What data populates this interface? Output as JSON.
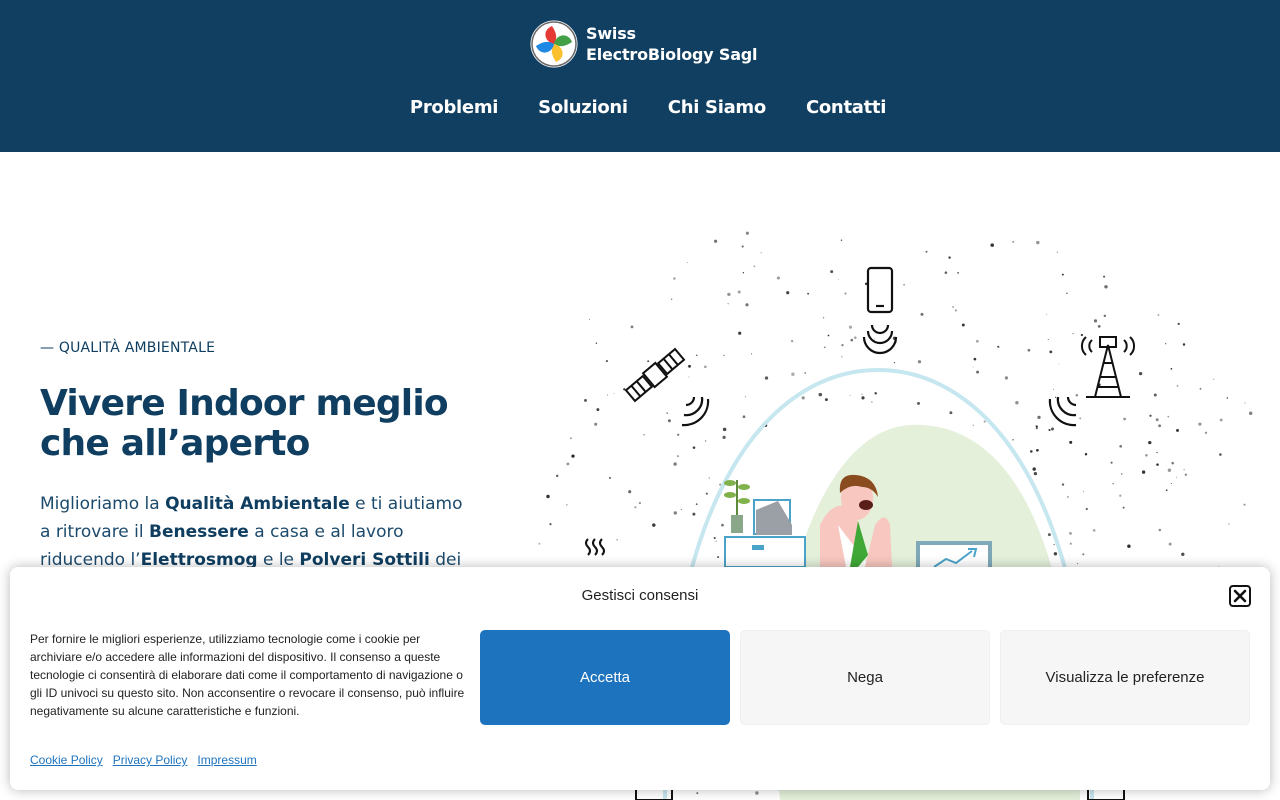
{
  "header": {
    "logo_line1": "Swiss",
    "logo_line2": "ElectroBiology Sagl",
    "nav": [
      "Problemi",
      "Soluzioni",
      "Chi Siamo",
      "Contatti"
    ]
  },
  "hero": {
    "eyebrow": "— QUALITÀ AMBIENTALE",
    "title": "Vivere Indoor meglio che all’aperto",
    "text_1": "Miglioriamo la ",
    "text_b1": "Qualità Ambientale",
    "text_2": " e ti aiutiamo a ritrovare il ",
    "text_b2": "Benessere",
    "text_3": " a casa e al lavoro riducendo l’",
    "text_b3": "Elettrosmog",
    "text_4": " e le ",
    "text_b4": "Polveri Sottili",
    "text_5": " dei tuoi ambienti"
  },
  "cookie": {
    "title": "Gestisci consensi",
    "text": "Per fornire le migliori esperienze, utilizziamo tecnologie come i cookie per archiviare e/o accedere alle informazioni del dispositivo. Il consenso a queste tecnologie ci consentirà di elaborare dati come il comportamento di navigazione o gli ID univoci su questo sito. Non acconsentire o revocare il consenso, può influire negativamente su alcune caratteristiche e funzioni.",
    "accept": "Accetta",
    "deny": "Nega",
    "preferences": "Visualizza le preferenze",
    "links": [
      "Cookie Policy",
      "Privacy Policy",
      "Impressum"
    ]
  },
  "colors": {
    "header_bg": "#103f61",
    "title_text": "#0f3e60",
    "accept_bg": "#1e73be",
    "link": "#1e73be"
  },
  "icons": [
    "logo-mark-icon",
    "smartphone-icon",
    "satellite-icon",
    "cell-tower-icon",
    "signal-waves-icon",
    "close-icon"
  ]
}
